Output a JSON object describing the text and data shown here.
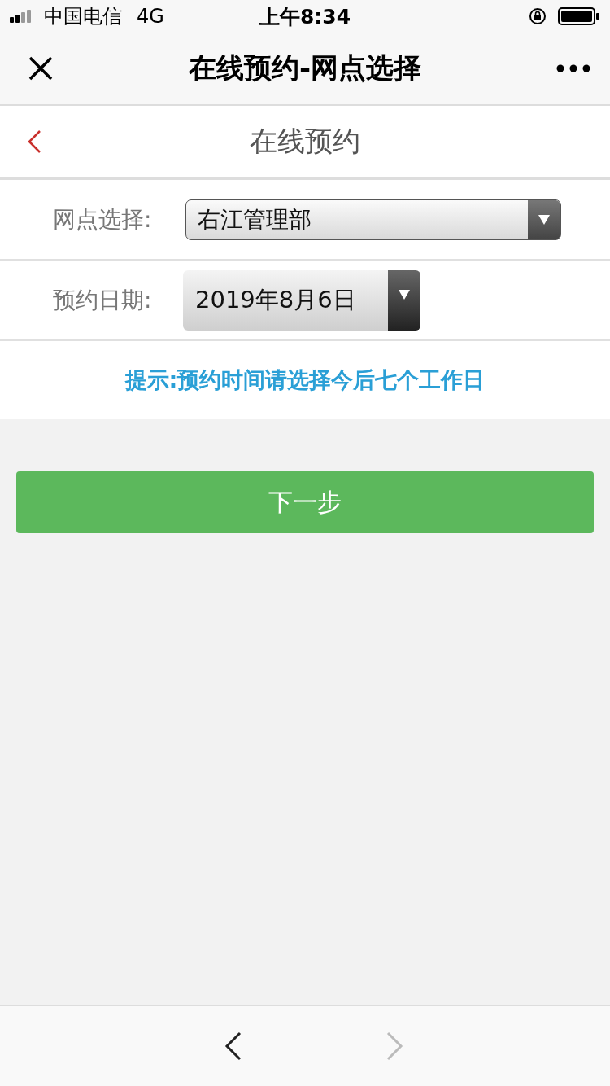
{
  "status_bar": {
    "carrier": "中国电信",
    "network": "4G",
    "time": "上午8:34"
  },
  "nav_bar": {
    "title": "在线预约-网点选择"
  },
  "page_header": {
    "title": "在线预约"
  },
  "form": [
    {
      "kind": "select",
      "label": "网点选择:",
      "value": "右江管理部"
    },
    {
      "kind": "date",
      "label": "预约日期:",
      "value": "2019年8月6日"
    }
  ],
  "hint": "提示:预约时间请选择今后七个工作日",
  "next_button": "下一步",
  "toolbar": {
    "back_disabled": false,
    "forward_disabled": true
  }
}
